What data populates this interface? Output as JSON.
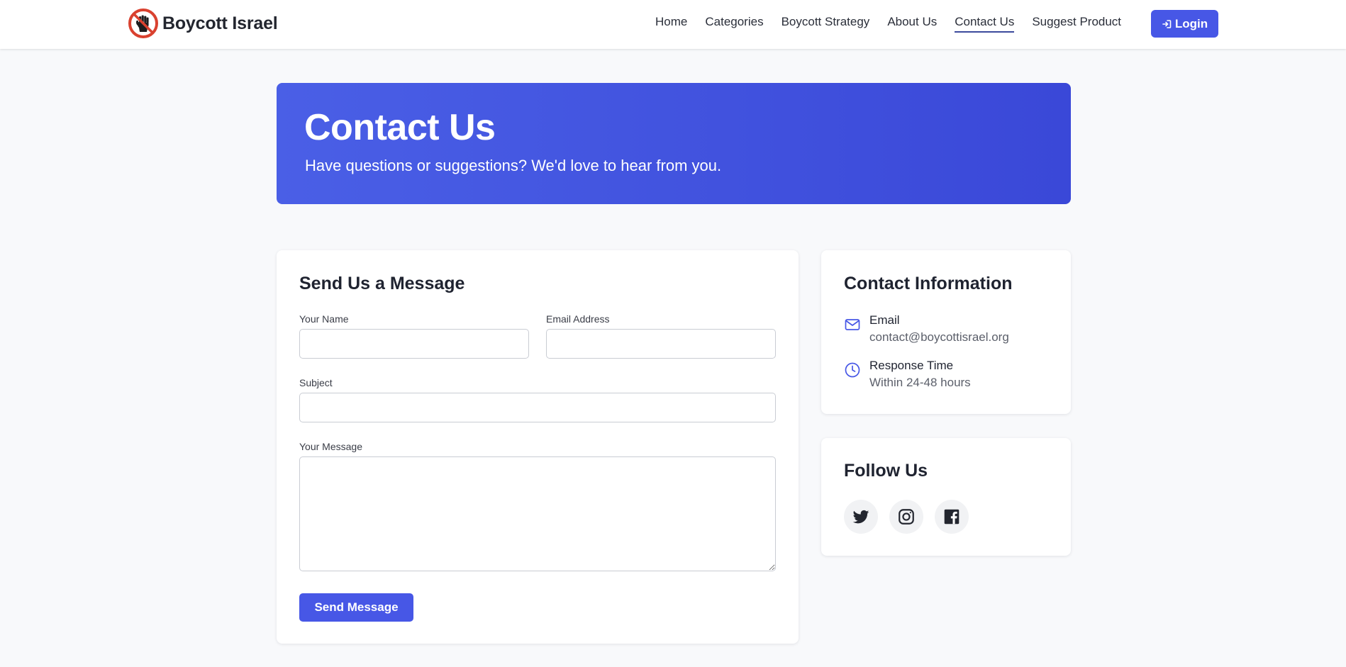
{
  "brand": {
    "name": "Boycott Israel",
    "logo_icon": "raised-fist-prohibited-icon"
  },
  "nav": {
    "items": [
      {
        "label": "Home",
        "active": false
      },
      {
        "label": "Categories",
        "active": false
      },
      {
        "label": "Boycott Strategy",
        "active": false
      },
      {
        "label": "About Us",
        "active": false
      },
      {
        "label": "Contact Us",
        "active": true
      },
      {
        "label": "Suggest Product",
        "active": false
      }
    ],
    "login_label": "Login",
    "login_icon": "sign-in-icon"
  },
  "hero": {
    "title": "Contact Us",
    "subtitle": "Have questions or suggestions? We'd love to hear from you."
  },
  "form": {
    "title": "Send Us a Message",
    "name_label": "Your Name",
    "name_value": "",
    "email_label": "Email Address",
    "email_value": "",
    "subject_label": "Subject",
    "subject_value": "",
    "message_label": "Your Message",
    "message_value": "",
    "submit_label": "Send Message"
  },
  "contact_info": {
    "title": "Contact Information",
    "items": [
      {
        "icon": "envelope-icon",
        "label": "Email",
        "value": "contact@boycottisrael.org"
      },
      {
        "icon": "clock-icon",
        "label": "Response Time",
        "value": "Within 24-48 hours"
      }
    ]
  },
  "follow": {
    "title": "Follow Us",
    "links": [
      {
        "icon": "twitter-icon"
      },
      {
        "icon": "instagram-icon"
      },
      {
        "icon": "facebook-icon"
      }
    ]
  },
  "colors": {
    "accent": "#4757e6",
    "hero_gradient_start": "#4a5fe6",
    "hero_gradient_end": "#3a48d8",
    "logo_ring": "#d9412f",
    "page_background": "#f8f9fb"
  }
}
